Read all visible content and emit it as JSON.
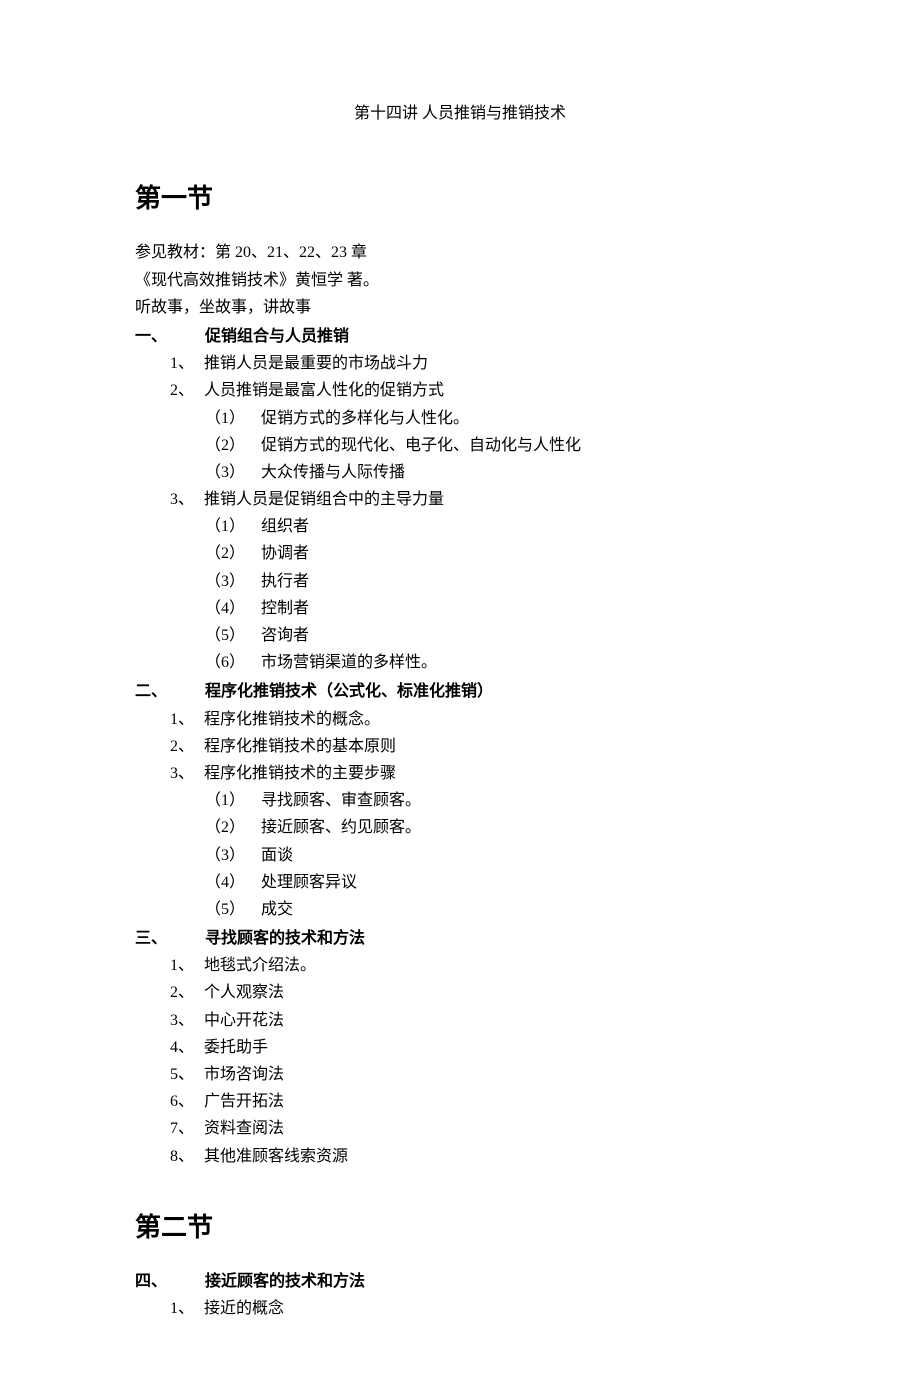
{
  "title": "第十四讲  人员推销与推销技术",
  "section1": "第一节",
  "intro": {
    "line1": "参见教材：第 20、21、22、23 章",
    "line2": "《现代高效推销技术》黄恒学 著。",
    "line3": "听故事，坐故事，讲故事"
  },
  "h1": {
    "num": "一、",
    "text": "促销组合与人员推销"
  },
  "h1_items": {
    "i1": {
      "num": "1、",
      "text": "推销人员是最重要的市场战斗力"
    },
    "i2": {
      "num": "2、",
      "text": "人员推销是最富人性化的促销方式"
    },
    "i2_sub": {
      "s1": {
        "num": "（1）",
        "text": "促销方式的多样化与人性化。"
      },
      "s2": {
        "num": "（2）",
        "text": "促销方式的现代化、电子化、自动化与人性化"
      },
      "s3": {
        "num": "（3）",
        "text": "大众传播与人际传播"
      }
    },
    "i3": {
      "num": "3、",
      "text": "推销人员是促销组合中的主导力量"
    },
    "i3_sub": {
      "s1": {
        "num": "（1）",
        "text": "组织者"
      },
      "s2": {
        "num": "（2）",
        "text": "协调者"
      },
      "s3": {
        "num": "（3）",
        "text": "执行者"
      },
      "s4": {
        "num": "（4）",
        "text": "控制者"
      },
      "s5": {
        "num": "（5）",
        "text": "咨询者"
      },
      "s6": {
        "num": "（6）",
        "text": "市场营销渠道的多样性。"
      }
    }
  },
  "h2": {
    "num": "二、",
    "text": "程序化推销技术（公式化、标准化推销）"
  },
  "h2_items": {
    "i1": {
      "num": "1、",
      "text": "程序化推销技术的概念。"
    },
    "i2": {
      "num": "2、",
      "text": "程序化推销技术的基本原则"
    },
    "i3": {
      "num": "3、",
      "text": "程序化推销技术的主要步骤"
    },
    "i3_sub": {
      "s1": {
        "num": "（1）",
        "text": "寻找顾客、审查顾客。"
      },
      "s2": {
        "num": "（2）",
        "text": "接近顾客、约见顾客。"
      },
      "s3": {
        "num": "（3）",
        "text": "面谈"
      },
      "s4": {
        "num": "（4）",
        "text": "处理顾客异议"
      },
      "s5": {
        "num": "（5）",
        "text": "成交"
      }
    }
  },
  "h3": {
    "num": "三、",
    "text": "寻找顾客的技术和方法"
  },
  "h3_items": {
    "i1": {
      "num": "1、",
      "text": "地毯式介绍法。"
    },
    "i2": {
      "num": "2、",
      "text": "个人观察法"
    },
    "i3": {
      "num": "3、",
      "text": "中心开花法"
    },
    "i4": {
      "num": "4、",
      "text": "委托助手"
    },
    "i5": {
      "num": "5、",
      "text": "市场咨询法"
    },
    "i6": {
      "num": "6、",
      "text": "广告开拓法"
    },
    "i7": {
      "num": "7、",
      "text": "资料查阅法"
    },
    "i8": {
      "num": "8、",
      "text": "其他准顾客线索资源"
    }
  },
  "section2": "第二节",
  "h4": {
    "num": "四、",
    "text": "接近顾客的技术和方法"
  },
  "h4_items": {
    "i1": {
      "num": "1、",
      "text": "接近的概念"
    }
  }
}
